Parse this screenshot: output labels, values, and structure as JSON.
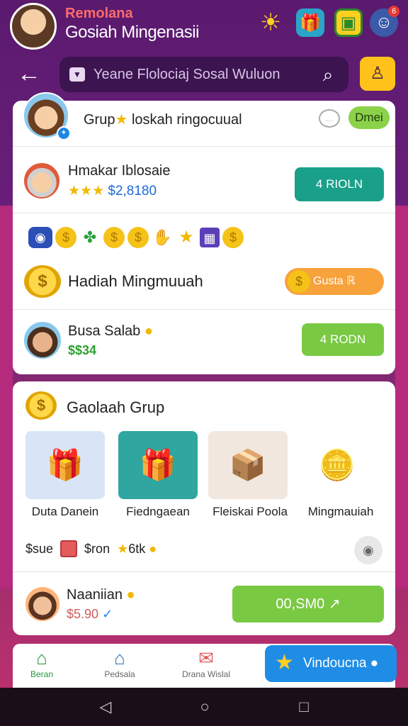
{
  "header": {
    "app_name": "Remolana",
    "subtitle": "Gosiah Mingenasii",
    "icons": [
      "sun-icon",
      "gift-icon",
      "shop-icon",
      "notification-icon"
    ],
    "notification_count": "6"
  },
  "search": {
    "placeholder": "Yeane Flolociaj Sosal Wuluon"
  },
  "group": {
    "title_prefix": "Grup",
    "title_suffix": "loskah ringocuual",
    "pill": "Dmei"
  },
  "player1": {
    "name": "Hmakar Iblosaie",
    "stars": "★★★",
    "amount": "$2,8180",
    "button": "4 RIOLN"
  },
  "strip_icons": [
    "robot-icon",
    "coin-icon",
    "clover-icon",
    "coin-icon",
    "coin-icon",
    "hand-icon",
    "star-icon",
    "cube-icon",
    "coin-icon"
  ],
  "weekly": {
    "title": "Hadiah Mingmuuah",
    "button": "Gusta ℝ"
  },
  "player2": {
    "name": "Busa Salab",
    "meta": "$$34",
    "button": "4 RODN"
  },
  "group_rewards": {
    "title": "Gaolaah Grup",
    "tiles": [
      {
        "label": "Duta Danein",
        "icon": "gift-box-icon"
      },
      {
        "label": "Fiedngaean",
        "icon": "gift-box-icon"
      },
      {
        "label": "Fleiskai Poola",
        "icon": "crate-icon"
      },
      {
        "label": "Mingmauiah",
        "icon": "character-icon"
      }
    ],
    "meta_a": "$sue",
    "meta_b": "$ron",
    "meta_c": "6tk"
  },
  "player3": {
    "name": "Naaniian",
    "amount": "$5.90",
    "button": "00,SM0 ↗"
  },
  "tabs": [
    {
      "label": "Beran",
      "icon": "home-icon"
    },
    {
      "label": "Pedsala",
      "icon": "shop-icon"
    },
    {
      "label": "Drana Wislal",
      "icon": "gift-icon"
    }
  ],
  "cta": {
    "label": "Vindoucna"
  }
}
